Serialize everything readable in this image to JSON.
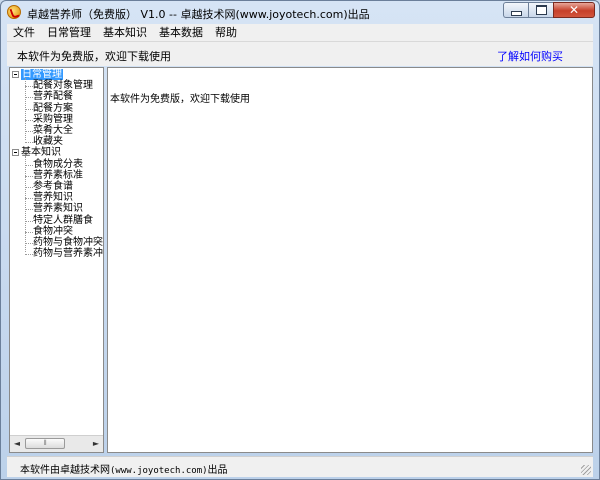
{
  "window": {
    "title": "卓越营养师（免费版） V1.0 -- 卓越技术网(www.joyotech.com)出品",
    "controls": {
      "minimize": "minimize",
      "maximize": "maximize",
      "close": "✕"
    }
  },
  "menu": [
    "文件",
    "日常管理",
    "基本知识",
    "基本数据",
    "帮助"
  ],
  "infobar": {
    "notice": "本软件为免费版，欢迎下载使用",
    "buy_link": "了解如何购买"
  },
  "tree": {
    "groups": [
      {
        "label": "日常管理",
        "expander": "⊟",
        "selected": true,
        "items": [
          "配餐对象管理",
          "营养配餐",
          "配餐方案",
          "采购管理",
          "菜肴大全",
          "收藏夹"
        ]
      },
      {
        "label": "基本知识",
        "expander": "⊟",
        "selected": false,
        "items": [
          "食物成分表",
          "营养素标准",
          "参考食谱",
          "营养知识",
          "营养素知识",
          "特定人群膳食",
          "食物冲突",
          "药物与食物冲突",
          "药物与营养素冲突"
        ]
      }
    ],
    "scrollbar": {
      "left": "◄",
      "right": "►",
      "thumb": "⦀"
    }
  },
  "content": {
    "text": "本软件为免费版，欢迎下载使用"
  },
  "statusbar": {
    "prefix": "本软件由卓越技术网",
    "url": "(www.joyotech.com)",
    "suffix": "出品"
  }
}
